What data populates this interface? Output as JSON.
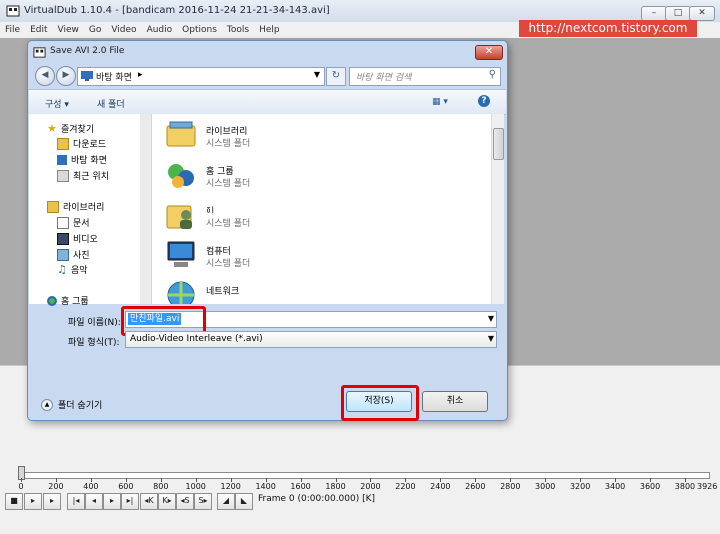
{
  "main_window": {
    "title": "VirtualDub 1.10.4 - [bandicam 2016-11-24 21-21-34-143.avi]",
    "menu": [
      "File",
      "Edit",
      "View",
      "Go",
      "Video",
      "Audio",
      "Options",
      "Tools",
      "Help"
    ]
  },
  "watermark": "http://nextcom.tistory.com",
  "timeline": {
    "ticks": [
      "0",
      "200",
      "400",
      "600",
      "800",
      "1000",
      "1200",
      "1400",
      "1600",
      "1800",
      "2000",
      "2200",
      "2400",
      "2600",
      "2800",
      "3000",
      "3200",
      "3400",
      "3600",
      "3800"
    ],
    "end_label": "3926",
    "max_frame": 3926,
    "current_frame": 0,
    "frame_readout": "Frame 0 (0:00:00.000) [K]"
  },
  "dialog": {
    "title": "Save AVI 2.0 File",
    "close_glyph": "✕",
    "address": "바탕 화면",
    "search_placeholder": "바탕 화면 검색",
    "commands": {
      "organize": "구성 ▾",
      "new_folder": "새 폴더"
    },
    "nav": [
      {
        "label": "즐겨찾기",
        "icon": "star-icon"
      },
      {
        "label": "다운로드",
        "icon": "download-folder-icon"
      },
      {
        "label": "바탕 화면",
        "icon": "desktop-icon"
      },
      {
        "label": "최근 위치",
        "icon": "recent-places-icon"
      },
      {
        "label": "라이브러리",
        "icon": "library-icon"
      },
      {
        "label": "문서",
        "icon": "documents-icon"
      },
      {
        "label": "비디오",
        "icon": "videos-icon"
      },
      {
        "label": "사진",
        "icon": "pictures-icon"
      },
      {
        "label": "음악",
        "icon": "music-icon"
      },
      {
        "label": "홈 그룹",
        "icon": "homegroup-icon"
      }
    ],
    "files": [
      {
        "name": "라이브러리",
        "type": "시스템 폴더",
        "icon": "library-icon"
      },
      {
        "name": "홈 그룹",
        "type": "시스템 폴더",
        "icon": "homegroup-icon"
      },
      {
        "name": "ᅙᆝ",
        "type": "시스템 폴더",
        "icon": "user-folder-icon"
      },
      {
        "name": "컴퓨터",
        "type": "시스템 폴더",
        "icon": "computer-icon"
      },
      {
        "name": "네트워크",
        "type": "",
        "icon": "network-icon"
      }
    ],
    "filename_label": "파일 이름(N):",
    "filename_value": "만친파일.avi",
    "filetype_label": "파일 형식(T):",
    "filetype_value": "Audio-Video Interleave (*.avi)",
    "hide_folders": "폴더 숨기기",
    "save_label": "저장(S)",
    "cancel_label": "취소"
  },
  "colors": {
    "highlight": "#e00000",
    "watermark_bg": "#e0473c",
    "selection": "#3399ff"
  }
}
